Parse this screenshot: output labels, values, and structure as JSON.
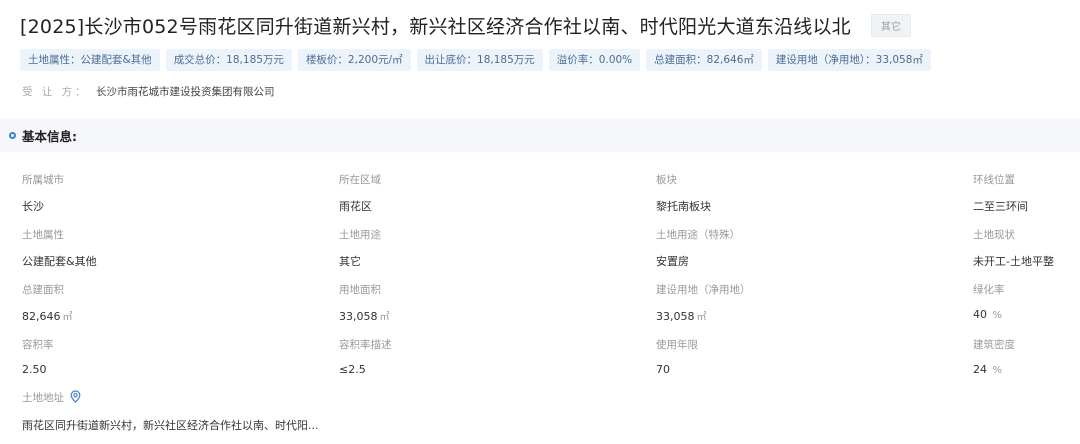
{
  "header": {
    "title": "[2025]长沙市052号雨花区同升街道新兴村，新兴社区经济合作社以南、时代阳光大道东沿线以北",
    "type_tag": "其它"
  },
  "summary_tags": [
    "土地属性：公建配套&其他",
    "成交总价：18,185万元",
    "楼板价：2,200元/㎡",
    "出让底价：18,185万元",
    "溢价率：0.00%",
    "总建面积：82,646㎡",
    "建设用地（净用地）：33,058㎡"
  ],
  "buyer": {
    "label": "受 让 方：",
    "value": "长沙市雨花城市建设投资集团有限公司"
  },
  "section": {
    "title": "基本信息:"
  },
  "info": {
    "city": {
      "label": "所属城市",
      "value": "长沙"
    },
    "district": {
      "label": "所在区域",
      "value": "雨花区"
    },
    "block": {
      "label": "板块",
      "value": "黎托南板块"
    },
    "ring": {
      "label": "环线位置",
      "value": "二至三环间"
    },
    "land_attr": {
      "label": "土地属性",
      "value": "公建配套&其他"
    },
    "land_use": {
      "label": "土地用途",
      "value": "其它"
    },
    "land_use_special": {
      "label": "土地用途（特殊）",
      "value": "安置房"
    },
    "land_status": {
      "label": "土地现状",
      "value": "未开工-土地平整"
    },
    "total_floor_area": {
      "label": "总建面积",
      "value": "82,646",
      "unit": "㎡"
    },
    "site_area": {
      "label": "用地面积",
      "value": "33,058",
      "unit": "㎡"
    },
    "construction_land": {
      "label": "建设用地（净用地）",
      "value": "33,058",
      "unit": "㎡"
    },
    "green_rate": {
      "label": "绿化率",
      "value": "40",
      "unit": "%"
    },
    "plot_ratio": {
      "label": "容积率",
      "value": "2.50"
    },
    "plot_ratio_desc": {
      "label": "容积率描述",
      "value": "≤2.5"
    },
    "use_years": {
      "label": "使用年限",
      "value": "70"
    },
    "building_density": {
      "label": "建筑密度",
      "value": "24",
      "unit": "%"
    },
    "address": {
      "label": "土地地址",
      "value": "雨花区同升街道新兴村，新兴社区经济合作社以南、时代阳..."
    }
  },
  "icons": {
    "section": "circle-bullet-icon",
    "address": "location-pin-icon"
  },
  "colors": {
    "accent": "#3d7fd6",
    "tag_bg": "#ecf3fb",
    "tag_text": "#4d6e94"
  }
}
